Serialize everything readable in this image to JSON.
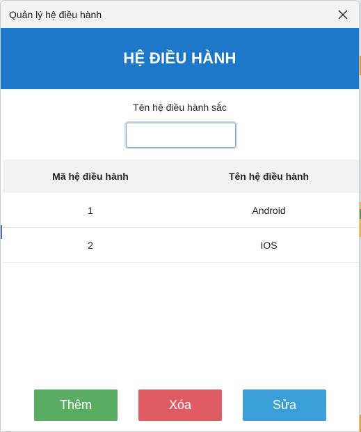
{
  "window": {
    "title": "Quản lý hệ điều hành"
  },
  "header": {
    "title": "HỆ ĐIỀU HÀNH",
    "color": "#1d78c9"
  },
  "form": {
    "name_label": "Tên hệ điều hành sắc",
    "name_value": "",
    "name_placeholder": ""
  },
  "table": {
    "columns": [
      "Mã hệ điều hành",
      "Tên hệ điều hành"
    ],
    "rows": [
      {
        "id": "1",
        "name": "Android"
      },
      {
        "id": "2",
        "name": "IOS"
      }
    ]
  },
  "buttons": {
    "add_label": "Thêm",
    "delete_label": "Xóa",
    "edit_label": "Sửa",
    "add_color": "#5aac62",
    "delete_color": "#e05c64",
    "edit_color": "#3a9fd9"
  },
  "icons": {
    "close": "close-icon"
  }
}
